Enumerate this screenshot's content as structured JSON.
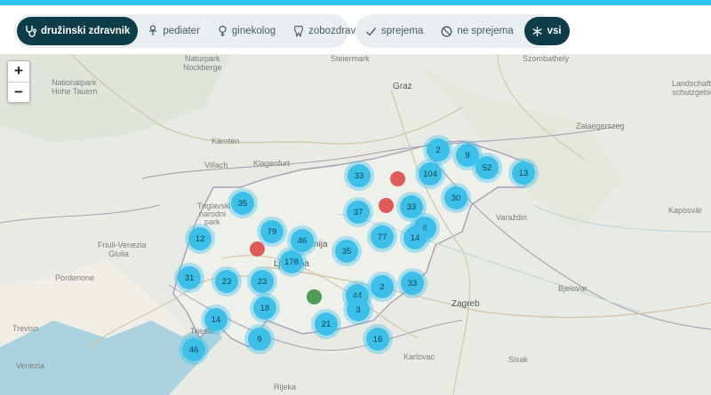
{
  "filters": {
    "doctor_types": [
      {
        "label": "družinski zdravnik",
        "icon": "stethoscope-icon",
        "active": true
      },
      {
        "label": "pediater",
        "icon": "pacifier-icon",
        "active": false
      },
      {
        "label": "ginekolog",
        "icon": "female-symbol-icon",
        "active": false
      },
      {
        "label": "zobozdravnik",
        "icon": "tooth-icon",
        "active": false
      }
    ],
    "acceptance": [
      {
        "label": "sprejema",
        "icon": "check-icon",
        "active": false
      },
      {
        "label": "ne sprejema",
        "icon": "no-entry-icon",
        "active": false
      },
      {
        "label": "vsi",
        "icon": "asterisk-icon",
        "active": true
      }
    ]
  },
  "zoom": {
    "in": "+",
    "out": "−"
  },
  "map_labels": [
    {
      "text": "Steiermark",
      "cls": ""
    },
    {
      "text": "Graz",
      "cls": "big"
    },
    {
      "text": "Szombathely",
      "cls": ""
    },
    {
      "text": "Nationalpark",
      "cls": ""
    },
    {
      "text": "Hohe Tauern",
      "cls": ""
    },
    {
      "text": "Naturpark",
      "cls": ""
    },
    {
      "text": "Nockberge",
      "cls": ""
    },
    {
      "text": "Landschafts-",
      "cls": ""
    },
    {
      "text": "schutzgebiet",
      "cls": ""
    },
    {
      "text": "Kärnten",
      "cls": ""
    },
    {
      "text": "Villach",
      "cls": ""
    },
    {
      "text": "Klagenfurt",
      "cls": ""
    },
    {
      "text": "Zalaegerszeg",
      "cls": ""
    },
    {
      "text": "Triglavski",
      "cls": ""
    },
    {
      "text": "narodni",
      "cls": ""
    },
    {
      "text": "park",
      "cls": ""
    },
    {
      "text": "Friuli-Venezia",
      "cls": ""
    },
    {
      "text": "Giulia",
      "cls": ""
    },
    {
      "text": "Slovenija",
      "cls": "big"
    },
    {
      "text": "Ljubljana",
      "cls": "big"
    },
    {
      "text": "Varaždin",
      "cls": ""
    },
    {
      "text": "Kaposvár",
      "cls": ""
    },
    {
      "text": "Pordenone",
      "cls": ""
    },
    {
      "text": "Bjelovar",
      "cls": ""
    },
    {
      "text": "Zagreb",
      "cls": "big"
    },
    {
      "text": "Treviso",
      "cls": ""
    },
    {
      "text": "Trieste",
      "cls": ""
    },
    {
      "text": "Venezia",
      "cls": ""
    },
    {
      "text": "Karlovac",
      "cls": ""
    },
    {
      "text": "Sisak",
      "cls": ""
    },
    {
      "text": "Rijeka",
      "cls": ""
    }
  ],
  "clusters": [
    "2",
    "9",
    "52",
    "13",
    "104",
    "33",
    "30",
    "33",
    "37",
    "6",
    "77",
    "14",
    "35",
    "79",
    "46",
    "12",
    "178",
    "35",
    "31",
    "23",
    "23",
    "44",
    "2",
    "33",
    "18",
    "3",
    "14",
    "21",
    "9",
    "16",
    "46"
  ],
  "status_markers": [
    {
      "status": "ne sprejema",
      "color": "#e05a5a"
    },
    {
      "status": "ne sprejema",
      "color": "#e05a5a"
    },
    {
      "status": "ne sprejema",
      "color": "#e05a5a"
    },
    {
      "status": "sprejema",
      "color": "#4e9b58"
    }
  ],
  "colors": {
    "accent": "#2ec3ec",
    "active_button": "#0d3d48",
    "cluster": "#3cc0ea",
    "not_accepting": "#e05a5a",
    "accepting": "#4e9b58"
  }
}
